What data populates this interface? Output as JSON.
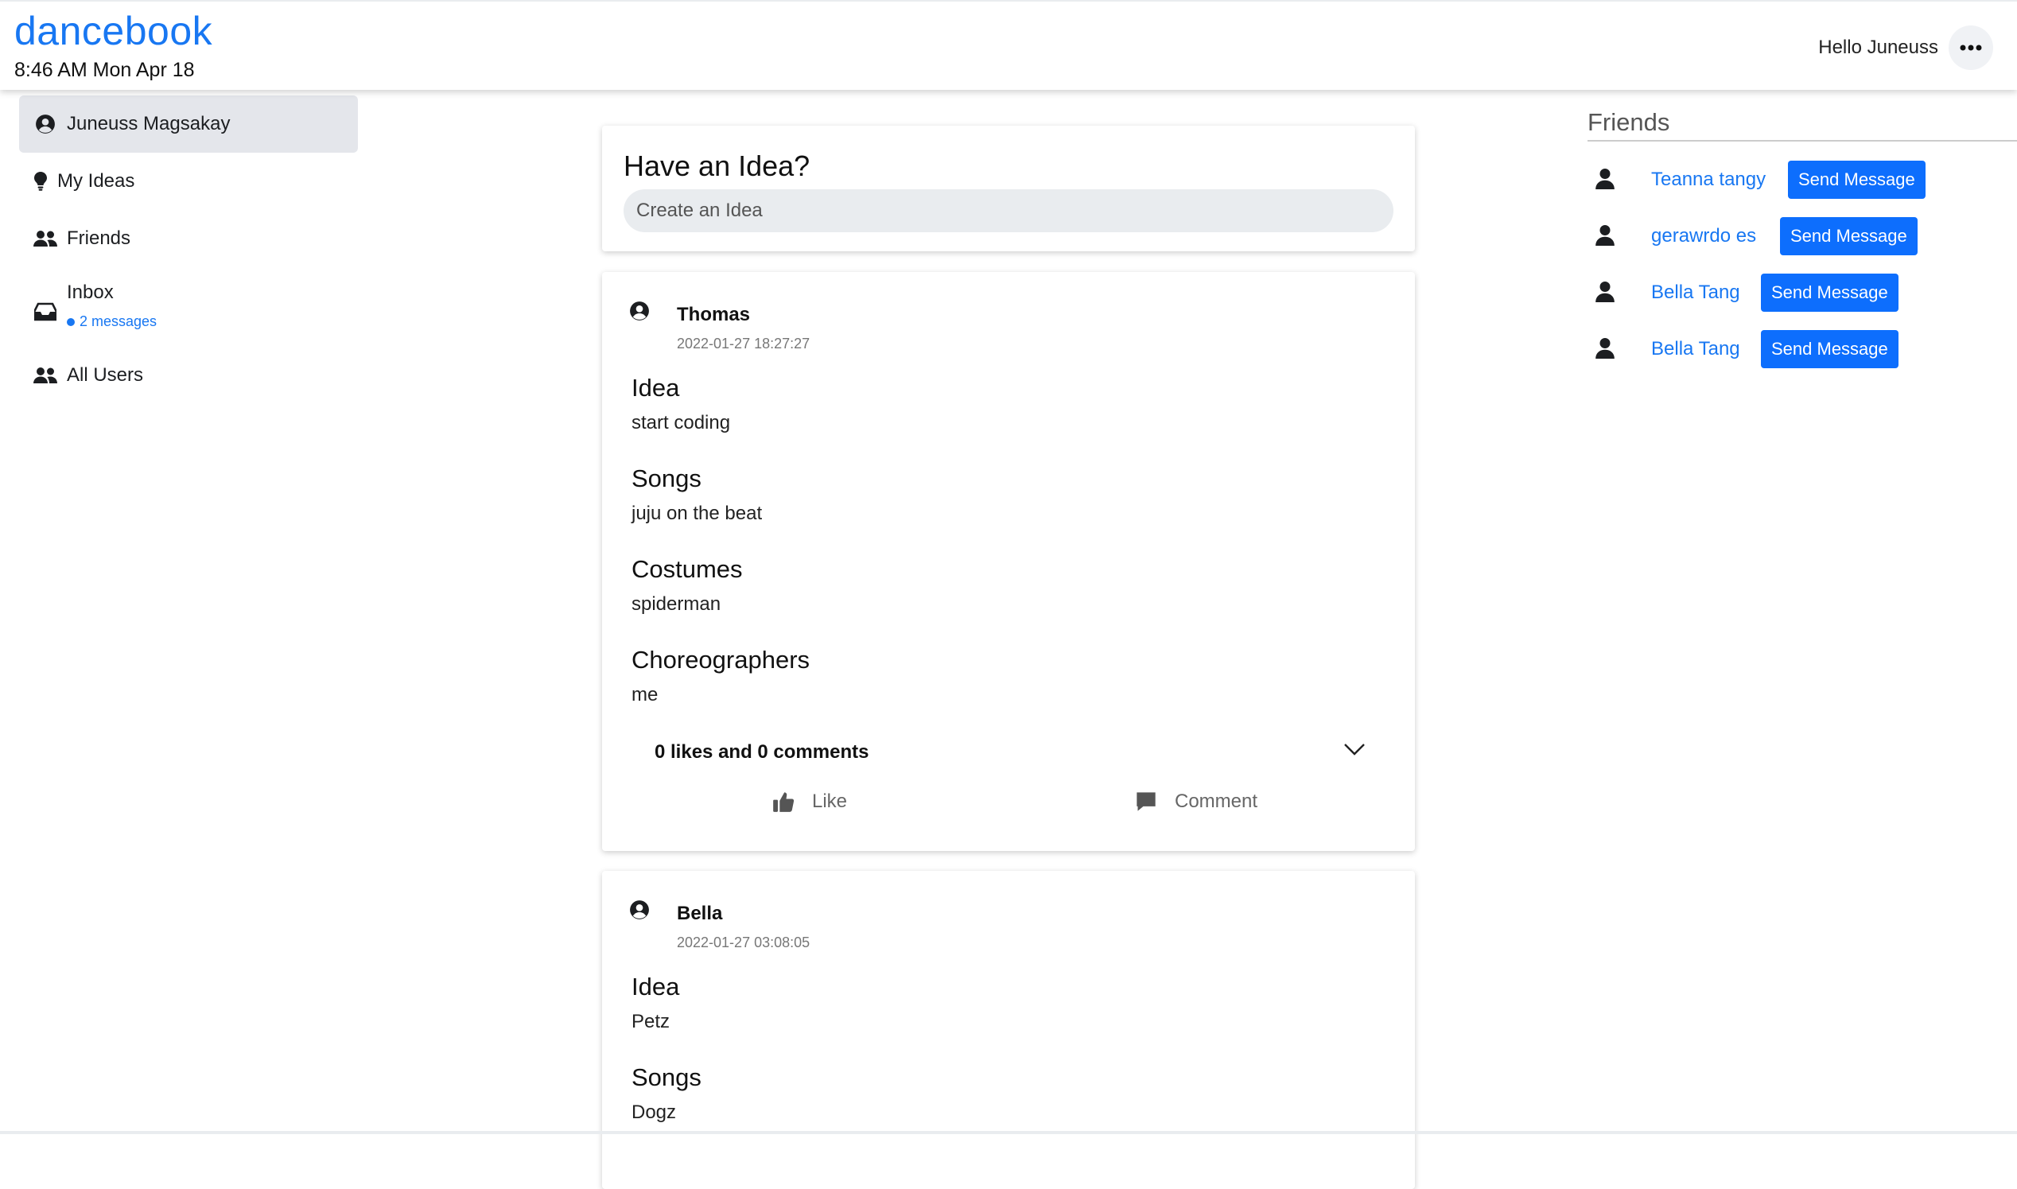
{
  "header": {
    "brand": "dancebook",
    "clock": "8:46 AM Mon Apr 18",
    "greeting": "Hello Juneuss"
  },
  "sidebar": {
    "items": [
      {
        "label": "Juneuss Magsakay",
        "icon": "user-circle-icon"
      },
      {
        "label": "My Ideas",
        "icon": "lightbulb-icon"
      },
      {
        "label": "Friends",
        "icon": "users-icon"
      },
      {
        "label": "Inbox",
        "icon": "inbox-icon",
        "badge": "2 messages"
      },
      {
        "label": "All Users",
        "icon": "users-icon"
      }
    ]
  },
  "compose": {
    "title": "Have an Idea?",
    "placeholder": "Create an Idea"
  },
  "posts": [
    {
      "author": "Thomas",
      "time": "2022-01-27 18:27:27",
      "fields": [
        {
          "title": "Idea",
          "value": "start coding"
        },
        {
          "title": "Songs",
          "value": "juju on the beat"
        },
        {
          "title": "Costumes",
          "value": "spiderman"
        },
        {
          "title": "Choreographers",
          "value": "me"
        }
      ],
      "meta": "0 likes and 0 comments",
      "like_label": "Like",
      "comment_label": "Comment"
    },
    {
      "author": "Bella",
      "time": "2022-01-27 03:08:05",
      "fields": [
        {
          "title": "Idea",
          "value": "Petz"
        },
        {
          "title": "Songs",
          "value": "Dogz"
        }
      ]
    }
  ],
  "friends": {
    "title": "Friends",
    "button_label": "Send Message",
    "list": [
      {
        "name": "Teanna tangy"
      },
      {
        "name": "gerawrdo es"
      },
      {
        "name": "Bella Tang"
      },
      {
        "name": "Bella Tang"
      }
    ]
  },
  "colors": {
    "accent": "#1877f2",
    "button": "#0d6efd",
    "active_bg": "#e4e6eb"
  }
}
